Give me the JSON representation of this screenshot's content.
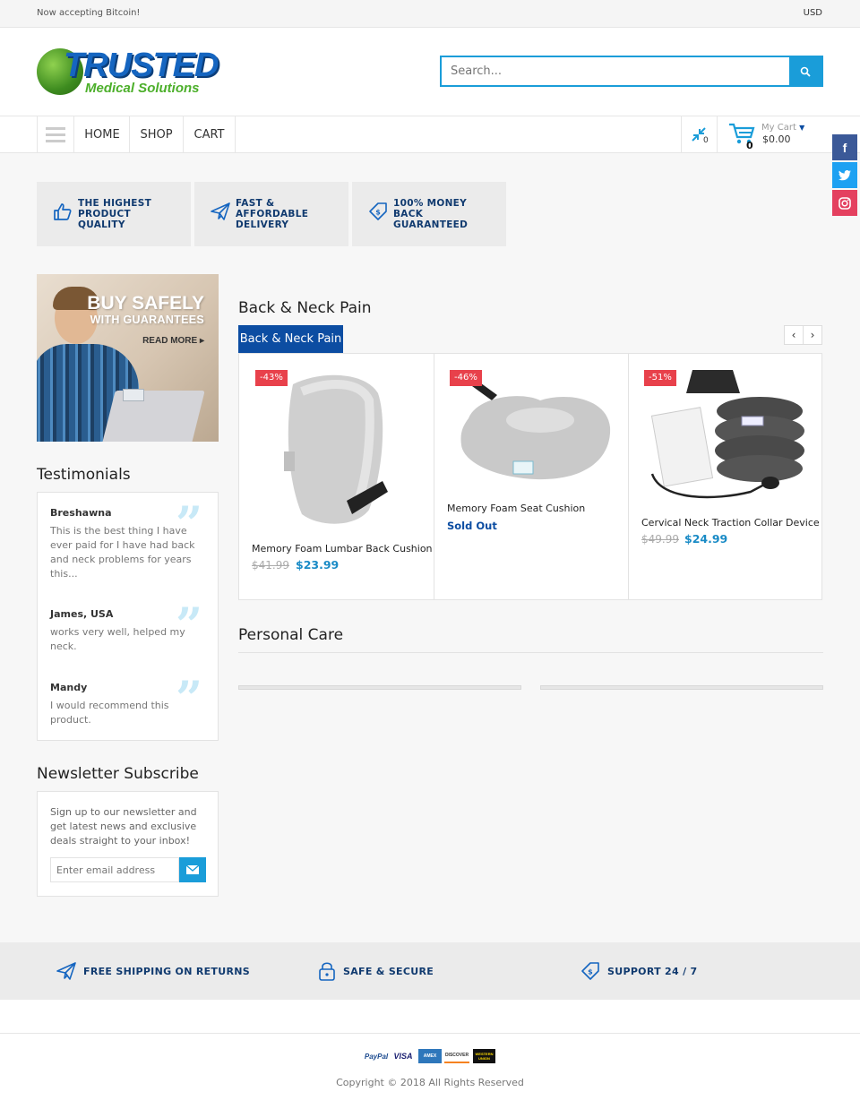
{
  "topbar": {
    "promo": "Now accepting Bitcoin!",
    "currency": "USD"
  },
  "header": {
    "logo_main": "TRUSTED",
    "logo_sub": "Medical Solutions",
    "search_placeholder": "Search..."
  },
  "nav": {
    "items": [
      "HOME",
      "SHOP",
      "CART"
    ],
    "compare_count": "0",
    "cart_count": "0",
    "cart_label": "My Cart",
    "cart_total": "$0.00"
  },
  "social": [
    {
      "name": "facebook",
      "glyph": "f",
      "color": "#3b5998"
    },
    {
      "name": "twitter",
      "glyph": "t",
      "color": "#1da1f2"
    },
    {
      "name": "instagram",
      "glyph": "◎",
      "color": "#e4405f"
    }
  ],
  "features": [
    {
      "icon": "thumbs-up-icon",
      "text": "THE HIGHEST PRODUCT QUALITY"
    },
    {
      "icon": "paper-plane-icon",
      "text": "FAST & AFFORDABLE DELIVERY"
    },
    {
      "icon": "money-tag-icon",
      "text": "100% MONEY BACK GUARANTEED"
    }
  ],
  "banner": {
    "line1": "BUY SAFELY",
    "line2": "WITH GUARANTEES",
    "line3": "READ MORE ▸"
  },
  "testimonials": {
    "title": "Testimonials",
    "items": [
      {
        "name": "Breshawna",
        "quote": "This is the best thing I have ever paid for I have had back and neck problems for years this..."
      },
      {
        "name": "James, USA",
        "quote": "works very well, helped my neck."
      },
      {
        "name": "Mandy",
        "quote": "I would recommend this product."
      }
    ]
  },
  "newsletter": {
    "title": "Newsletter Subscribe",
    "description": "Sign up to our newsletter and get latest news and exclusive deals straight to your inbox!",
    "placeholder": "Enter email address"
  },
  "back_neck": {
    "title": "Back & Neck Pain",
    "tab": "Back & Neck Pain",
    "products": [
      {
        "badge": "-43%",
        "name": "Memory Foam Lumbar Back Cushion",
        "old_price": "$41.99",
        "price": "$23.99"
      },
      {
        "badge": "-46%",
        "name": "Memory Foam Seat Cushion",
        "status": "Sold Out"
      },
      {
        "badge": "-51%",
        "name": "Cervical Neck Traction Collar Device",
        "old_price": "$49.99",
        "price": "$24.99"
      }
    ]
  },
  "personal_care": {
    "title": "Personal Care"
  },
  "footer_band": [
    {
      "icon": "paper-plane-icon",
      "text": "FREE SHIPPING ON RETURNS"
    },
    {
      "icon": "lock-icon",
      "text": "SAFE & SECURE"
    },
    {
      "icon": "money-tag-icon",
      "text": "SUPPORT 24 / 7"
    }
  ],
  "payments": [
    "PayPal",
    "VISA",
    "AMEX",
    "DISCOVER",
    "WESTERN UNION"
  ],
  "copyright": "Copyright © 2018 All Rights Reserved",
  "colors": {
    "accent": "#1a9dd9",
    "navy": "#0c4da2",
    "sale": "#e8414b",
    "price": "#1a8bc6"
  }
}
